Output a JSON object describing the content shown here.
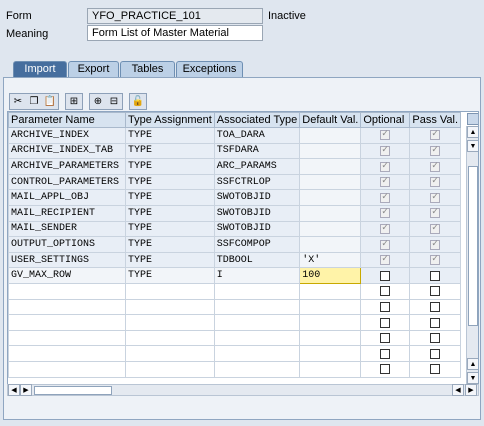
{
  "header": {
    "form_label": "Form",
    "form_value": "YFO_PRACTICE_101",
    "status": "Inactive",
    "meaning_label": "Meaning",
    "meaning_value": "Form List of Master Material"
  },
  "tabs": [
    "Import",
    "Export",
    "Tables",
    "Exceptions"
  ],
  "active_tab": "Import",
  "toolbar_icons": [
    "cut-icon",
    "copy-icon",
    "paste-icon",
    "insert-row-icon",
    "append-row-icon",
    "delete-row-icon",
    "lock-icon"
  ],
  "table": {
    "columns": [
      "Parameter Name",
      "Type Assignment",
      "Associated Type",
      "Default Val.",
      "Optional",
      "Pass Val."
    ],
    "rows": [
      {
        "name": "ARCHIVE_INDEX",
        "type": "TYPE",
        "assoc": "TOA_DARA",
        "default": "",
        "optional": true,
        "pass": true
      },
      {
        "name": "ARCHIVE_INDEX_TAB",
        "type": "TYPE",
        "assoc": "TSFDARA",
        "default": "",
        "optional": true,
        "pass": true
      },
      {
        "name": "ARCHIVE_PARAMETERS",
        "type": "TYPE",
        "assoc": "ARC_PARAMS",
        "default": "",
        "optional": true,
        "pass": true
      },
      {
        "name": "CONTROL_PARAMETERS",
        "type": "TYPE",
        "assoc": "SSFCTRLOP",
        "default": "",
        "optional": true,
        "pass": true
      },
      {
        "name": "MAIL_APPL_OBJ",
        "type": "TYPE",
        "assoc": "SWOTOBJID",
        "default": "",
        "optional": true,
        "pass": true
      },
      {
        "name": "MAIL_RECIPIENT",
        "type": "TYPE",
        "assoc": "SWOTOBJID",
        "default": "",
        "optional": true,
        "pass": true
      },
      {
        "name": "MAIL_SENDER",
        "type": "TYPE",
        "assoc": "SWOTOBJID",
        "default": "",
        "optional": true,
        "pass": true
      },
      {
        "name": "OUTPUT_OPTIONS",
        "type": "TYPE",
        "assoc": "SSFCOMPOP",
        "default": "",
        "optional": true,
        "pass": true
      },
      {
        "name": "USER_SETTINGS",
        "type": "TYPE",
        "assoc": "TDBOOL",
        "default": "'X'",
        "optional": true,
        "pass": true
      },
      {
        "name": "GV_MAX_ROW",
        "type": "TYPE",
        "assoc": "I",
        "default": "100",
        "optional": false,
        "pass": false
      }
    ],
    "empty_rows": 6
  },
  "colors": {
    "active_tab": "#466e9e",
    "inactive_tab": "#bcd0e6",
    "focus_cell": "#fff3a8"
  }
}
